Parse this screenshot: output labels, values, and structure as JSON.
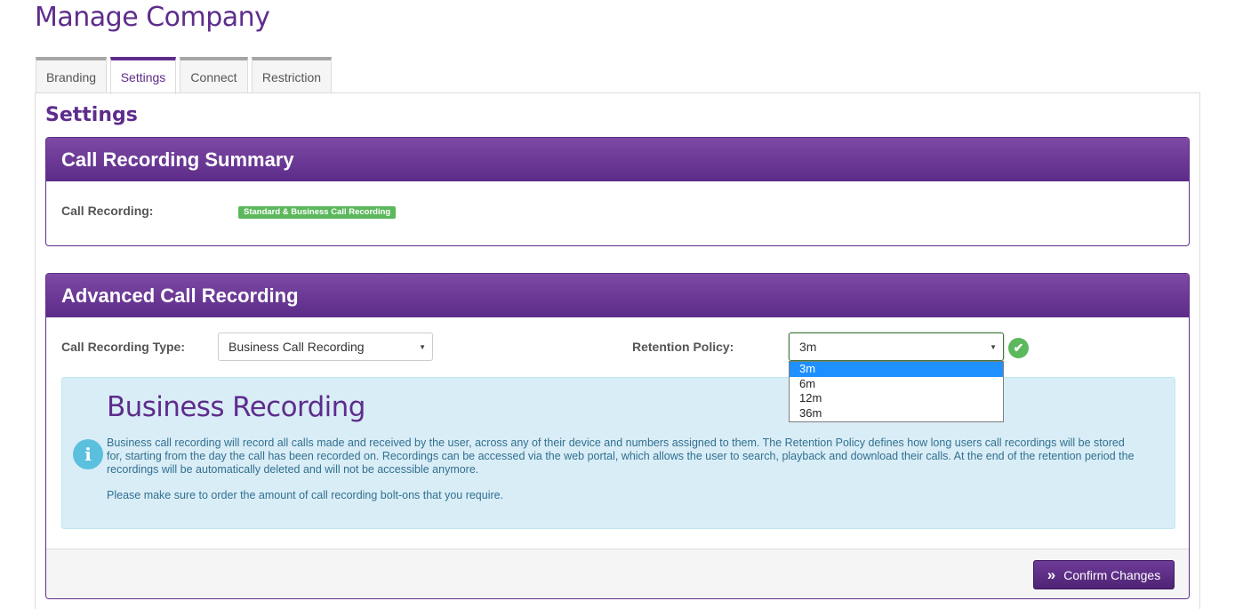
{
  "page": {
    "title": "Manage Company"
  },
  "tabs": [
    {
      "label": "Branding",
      "active": false
    },
    {
      "label": "Settings",
      "active": true
    },
    {
      "label": "Connect",
      "active": false
    },
    {
      "label": "Restriction",
      "active": false
    }
  ],
  "settings": {
    "title": "Settings"
  },
  "summary": {
    "title": "Call Recording Summary",
    "call_recording_label": "Call Recording:",
    "call_recording_badge": "Standard & Business Call Recording"
  },
  "advanced": {
    "title": "Advanced Call Recording",
    "type_label": "Call Recording Type:",
    "type_value": "Business Call Recording",
    "retention_label": "Retention Policy:",
    "retention_value": "3m",
    "retention_options": [
      "3m",
      "6m",
      "12m",
      "36m"
    ],
    "retention_highlighted": "3m",
    "info": {
      "heading": "Business Recording",
      "body": "Business call recording will record all calls made and received by the user, across any of their device and numbers assigned to them. The Retention Policy defines how long users call recordings will be stored for, starting from the day the call has been recorded on. Recordings can be accessed via the web portal, which allows the user to search, playback and download their calls. At the end of the retention period the recordings will be automatically deleted and will not be accessible anymore.",
      "note": "Please make sure to order the amount of call recording bolt-ons that you require."
    },
    "confirm_label": "Confirm Changes"
  },
  "colors": {
    "brand": "#5e2d8c",
    "success": "#5cb85c",
    "info_bg": "#d9edf7",
    "info_text": "#31708f"
  }
}
